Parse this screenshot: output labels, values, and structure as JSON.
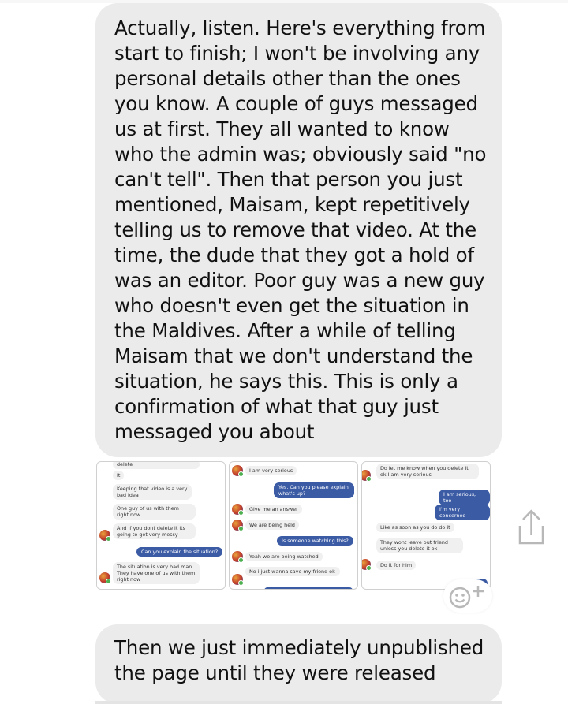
{
  "messages": [
    {
      "text": "Actually, listen. Here's everything from start to finish; I won't be involving any personal details other than the ones you know. A couple of guys messaged us at first. They all wanted to know who the admin was; obviously said \"no can't tell\". Then that person you just mentioned, Maisam, kept repetitively telling us to remove that video. At the time, the dude that they got a hold of was an editor. Poor guy was a new guy who doesn't even get the situation in the Maldives. After a while of telling Maisam that we don't understand the situation, he says this. This is only a confirmation of what that guy just messaged you about"
    },
    {
      "text": "Then we just immediately unpublished the page until they were released"
    }
  ],
  "screenshots": [
    {
      "lines": [
        {
          "text": "delete",
          "side": "in"
        },
        {
          "text": "It",
          "side": "in"
        },
        {
          "text": "Keeping that video is a very bad idea",
          "side": "in"
        },
        {
          "text": "One guy of us with them right now",
          "side": "in"
        },
        {
          "text": "And if you dont delete it its going to get very messy",
          "side": "in"
        },
        {
          "text": "Can you explain the situation?",
          "side": "out"
        },
        {
          "text": "The situation is very bad man. They have one of us with them right now",
          "side": "in"
        }
      ]
    },
    {
      "lines": [
        {
          "text": "I am very serious",
          "side": "in"
        },
        {
          "text": "Yes. Can you please explain what's up?",
          "side": "out"
        },
        {
          "text": "Give me an answer",
          "side": "in"
        },
        {
          "text": "We are being held",
          "side": "in"
        },
        {
          "text": "Is someone watching this?",
          "side": "out"
        },
        {
          "text": "Yeah we are being watched",
          "side": "in"
        },
        {
          "text": "No i just wanna save my friend ok",
          "side": "in"
        }
      ]
    },
    {
      "lines": [
        {
          "text": "Do let me know when you delete it ok I am very serious",
          "side": "in"
        },
        {
          "text": "I am serious, too",
          "side": "out"
        },
        {
          "text": "I'm very concerned",
          "side": "out"
        },
        {
          "text": "Like as soon as you do do it",
          "side": "in"
        },
        {
          "text": "They wont leave out friend unless you delete it ok",
          "side": "in"
        },
        {
          "text": "Do it for him",
          "side": "in"
        }
      ]
    }
  ],
  "icons": {
    "share": "share-icon",
    "emoji": "add-reaction-icon"
  },
  "colors": {
    "bubble": "#ebebeb",
    "sent": "#3b5ba5",
    "icon": "#b8b8b8"
  }
}
